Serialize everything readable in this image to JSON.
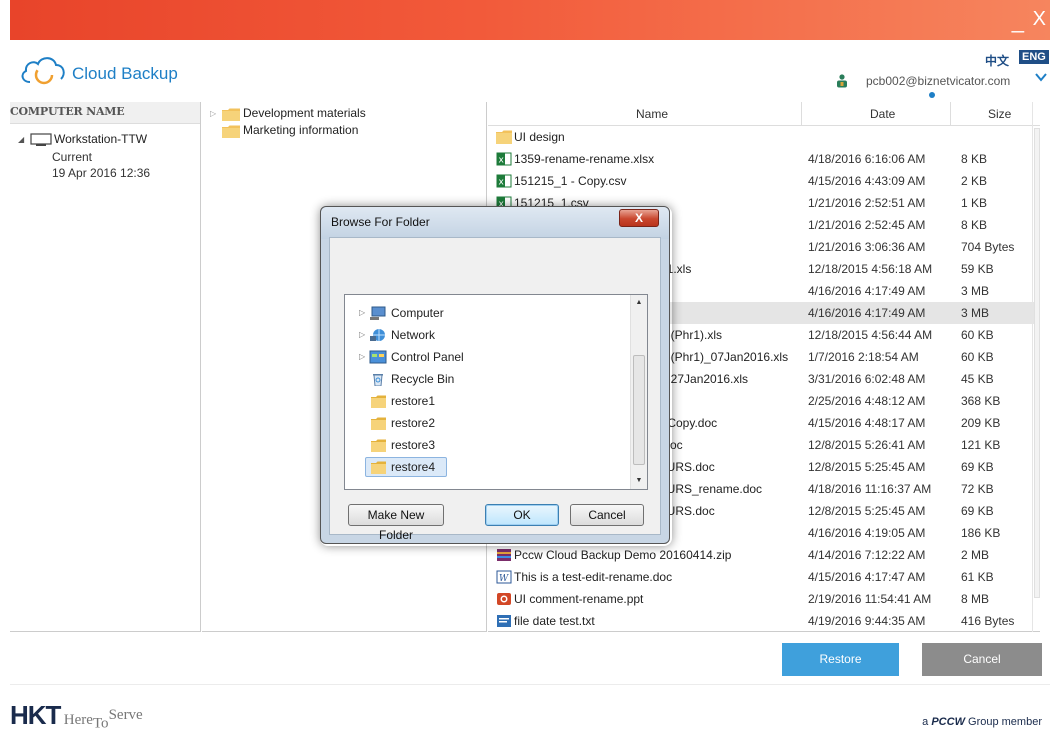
{
  "titlebar": {
    "minimize": "_",
    "close": "X"
  },
  "header": {
    "app_name": "Cloud Backup",
    "lang_zh": "中文",
    "lang_en": "ENG",
    "user_email": "pcb002@biznetvicator.com"
  },
  "left_panel": {
    "column_header": "COMPUTER NAME",
    "computer": "Workstation-TTW",
    "status": "Current",
    "timestamp": "19 Apr 2016 12:36"
  },
  "mid_panel": {
    "folders": [
      "Development materials",
      "Marketing information"
    ]
  },
  "file_list": {
    "columns": {
      "name": "Name",
      "date": "Date",
      "size": "Size"
    },
    "rows": [
      {
        "name": "UI design",
        "date": "",
        "size": "",
        "icon": "folder-icon"
      },
      {
        "name": "1359-rename-rename.xlsx",
        "date": "4/18/2016 6:16:06 AM",
        "size": "8 KB",
        "icon": "excel-icon"
      },
      {
        "name": "151215_1 - Copy.csv",
        "date": "4/15/2016 4:43:09 AM",
        "size": "2 KB",
        "icon": "excel-icon"
      },
      {
        "name": "151215_1.csv",
        "date": "1/21/2016 2:52:51 AM",
        "size": "1 KB",
        "icon": "excel-icon"
      },
      {
        "name": "",
        "date": "1/21/2016 2:52:45 AM",
        "size": "8 KB",
        "icon": ""
      },
      {
        "name": "",
        "date": "1/21/2016 3:06:36 AM",
        "size": "704 Bytes",
        "icon": ""
      },
      {
        "name": "_1.xls",
        "date": "12/18/2015 4:56:18 AM",
        "size": "59 KB",
        "icon": ""
      },
      {
        "name": "",
        "date": "4/16/2016 4:17:49 AM",
        "size": "3 MB",
        "icon": ""
      },
      {
        "name": "",
        "date": "4/16/2016 4:17:49 AM",
        "size": "3 MB",
        "icon": "",
        "selected": true
      },
      {
        "name": "n-(Phr1).xls",
        "date": "12/18/2015 4:56:44 AM",
        "size": "60 KB",
        "icon": ""
      },
      {
        "name": "n-(Phr1)_07Jan2016.xls",
        "date": "1/7/2016 2:18:54 AM",
        "size": "60 KB",
        "icon": ""
      },
      {
        "name": "n-27Jan2016.xls",
        "date": "3/31/2016 6:02:48 AM",
        "size": "45 KB",
        "icon": ""
      },
      {
        "name": "",
        "date": "2/25/2016 4:48:12 AM",
        "size": "368 KB",
        "icon": ""
      },
      {
        "name": "- Copy.doc",
        "date": "4/15/2016 4:48:17 AM",
        "size": "209 KB",
        "icon": ""
      },
      {
        "name": ".doc",
        "date": "12/8/2015 5:26:41 AM",
        "size": "121 KB",
        "icon": ""
      },
      {
        "name": "_URS.doc",
        "date": "12/8/2015 5:25:45 AM",
        "size": "69 KB",
        "icon": ""
      },
      {
        "name": "_URS_rename.doc",
        "date": "4/18/2016 11:16:37 AM",
        "size": "72 KB",
        "icon": ""
      },
      {
        "name": "_URS.doc",
        "date": "12/8/2015 5:25:45 AM",
        "size": "69 KB",
        "icon": ""
      },
      {
        "name": "",
        "date": "4/16/2016 4:19:05 AM",
        "size": "186 KB",
        "icon": ""
      },
      {
        "name": "Pccw Cloud Backup Demo 20160414.zip",
        "date": "4/14/2016 7:12:22 AM",
        "size": "2 MB",
        "icon": "zip-icon"
      },
      {
        "name": "This is a test-edit-rename.doc",
        "date": "4/15/2016 4:17:47 AM",
        "size": "61 KB",
        "icon": "word-icon"
      },
      {
        "name": "UI comment-rename.ppt",
        "date": "2/19/2016 11:54:41 AM",
        "size": "8 MB",
        "icon": "ppt-icon"
      },
      {
        "name": "file date test.txt",
        "date": "4/19/2016 9:44:35 AM",
        "size": "416 Bytes",
        "icon": "txt-icon"
      }
    ]
  },
  "dialog": {
    "title": "Browse For Folder",
    "close": "X",
    "tree": [
      {
        "label": "Computer",
        "icon": "computer-icon",
        "expandable": true
      },
      {
        "label": "Network",
        "icon": "network-icon",
        "expandable": true
      },
      {
        "label": "Control Panel",
        "icon": "control-panel-icon",
        "expandable": true
      },
      {
        "label": "Recycle Bin",
        "icon": "recycle-bin-icon",
        "expandable": false
      },
      {
        "label": "restore1",
        "icon": "folder-icon",
        "expandable": false
      },
      {
        "label": "restore2",
        "icon": "folder-icon",
        "expandable": false
      },
      {
        "label": "restore3",
        "icon": "folder-icon",
        "expandable": false
      },
      {
        "label": "restore4",
        "icon": "folder-icon",
        "expandable": false,
        "selected": true
      }
    ],
    "buttons": {
      "new_folder": "Make New Folder",
      "ok": "OK",
      "cancel": "Cancel"
    }
  },
  "actions": {
    "restore": "Restore",
    "cancel": "Cancel"
  },
  "footer": {
    "logo": "HKT",
    "tagline_here": "Here",
    "tagline_to": "To",
    "tagline_serve": "Serve",
    "member_prefix": "a",
    "member_brand": "PCCW",
    "member_suffix": "Group member"
  },
  "colors": {
    "titlebar": "#ef4f32",
    "brand_blue": "#1e7fc6",
    "restore_button": "#3fa0dc",
    "cancel_button": "#8c8c8c",
    "selected_row": "#e5e5e5"
  }
}
